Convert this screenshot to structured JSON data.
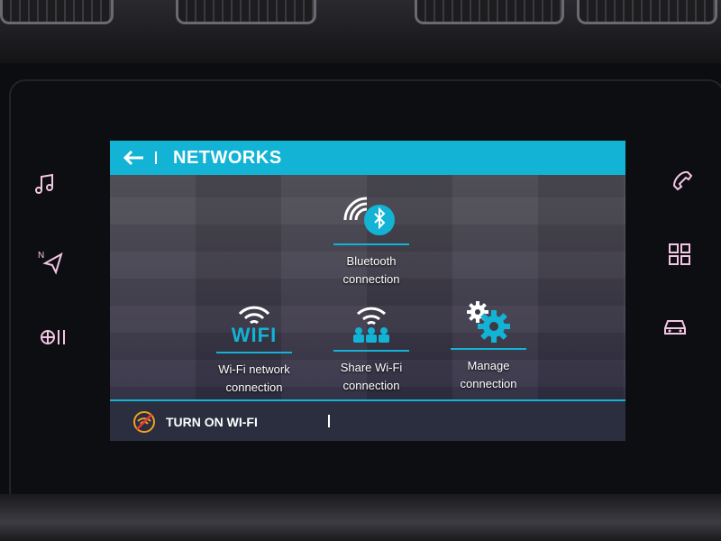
{
  "header": {
    "title": "NETWORKS"
  },
  "tiles": [
    {
      "label1": "Bluetooth",
      "label2": "connection",
      "icon": "bluetooth-icon"
    },
    {
      "label1": "Wi-Fi network",
      "label2": "connection",
      "icon": "wifi-icon",
      "icon_text": "WIFI"
    },
    {
      "label1": "Share Wi-Fi",
      "label2": "connection",
      "icon": "share-wifi-icon"
    },
    {
      "label1": "Manage",
      "label2": "connection",
      "icon": "gears-icon"
    }
  ],
  "bottom": {
    "label": "TURN ON WI-FI",
    "icon": "wifi-off-icon"
  },
  "side_left": [
    "music-icon",
    "navigation-icon",
    "climate-icon"
  ],
  "side_right": [
    "phone-icon",
    "apps-icon",
    "car-icon"
  ],
  "colors": {
    "accent": "#13b3d6",
    "header_text": "#ffffff",
    "side_icons": "#f3c6e3"
  }
}
